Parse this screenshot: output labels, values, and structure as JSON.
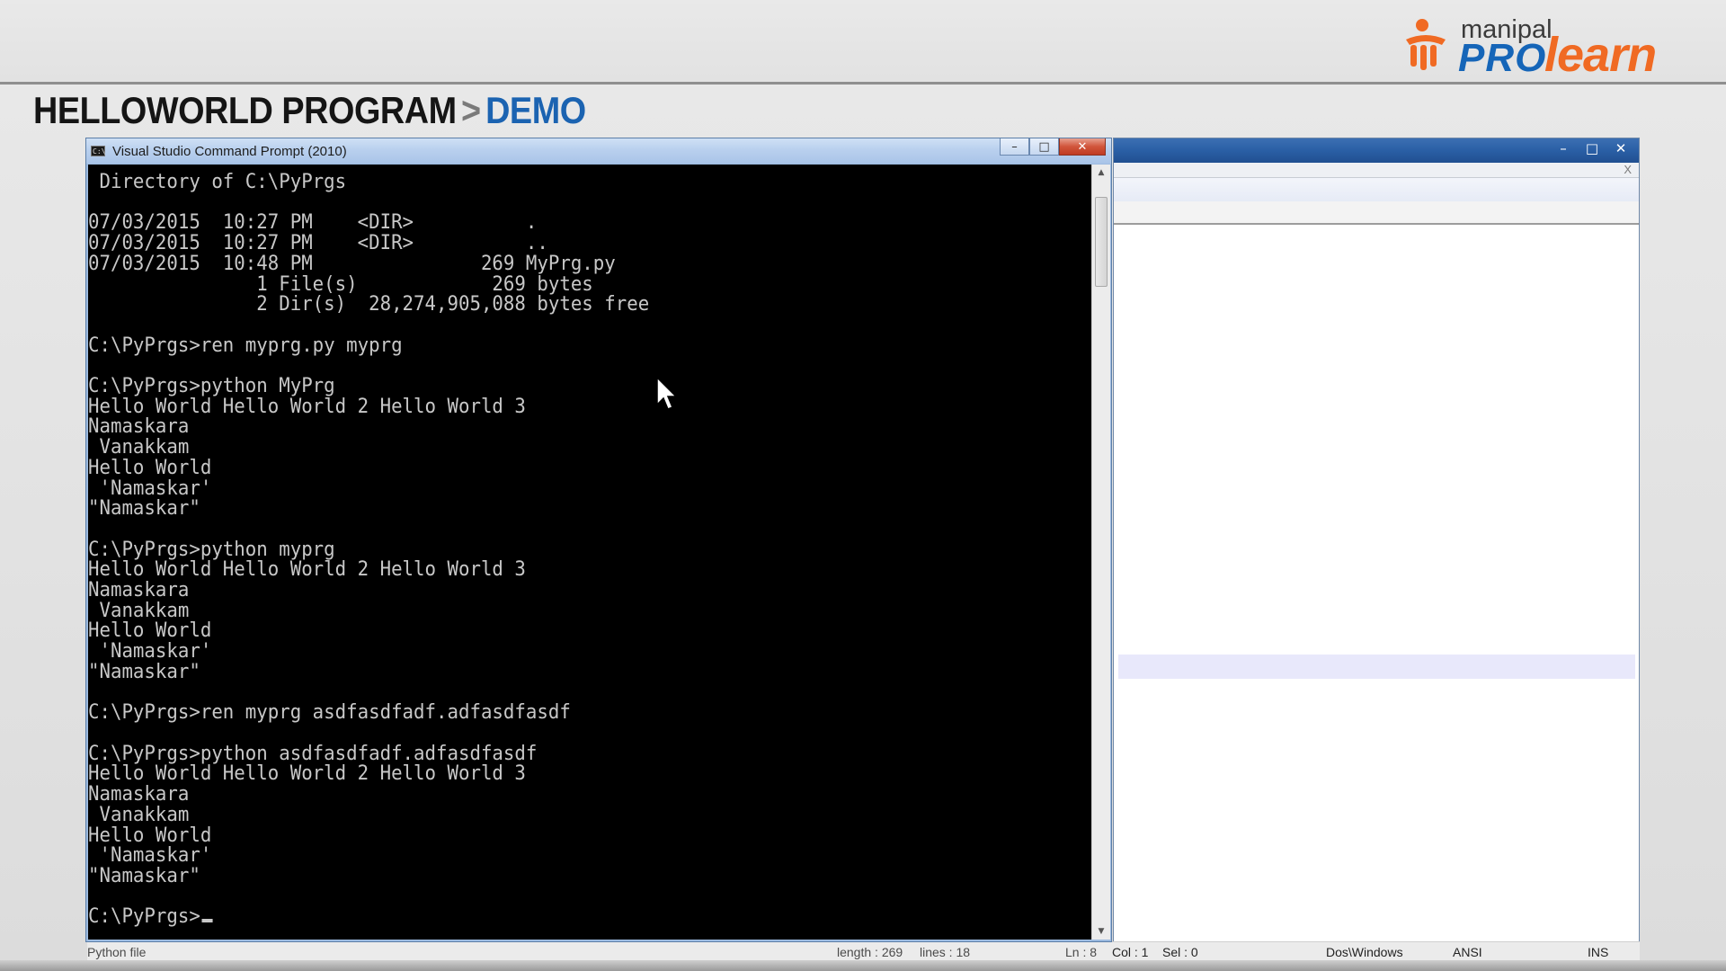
{
  "header": {
    "logo": {
      "manipal": "manipal",
      "pro": "PRO",
      "learn": "learn"
    },
    "title": "HELLOWORLD PROGRAM",
    "separator": ">",
    "subtitle": "DEMO"
  },
  "cmd_window": {
    "title": "Visual Studio Command Prompt (2010)",
    "buttons": {
      "minimize": "–",
      "maximize": "□",
      "close": "✕"
    },
    "console_lines": [
      " Directory of C:\\PyPrgs",
      "",
      "07/03/2015  10:27 PM    <DIR>          .",
      "07/03/2015  10:27 PM    <DIR>          ..",
      "07/03/2015  10:48 PM               269 MyPrg.py",
      "               1 File(s)            269 bytes",
      "               2 Dir(s)  28,274,905,088 bytes free",
      "",
      "C:\\PyPrgs>ren myprg.py myprg",
      "",
      "C:\\PyPrgs>python MyPrg",
      "Hello World Hello World 2 Hello World 3",
      "Namaskara",
      " Vanakkam",
      "Hello World",
      " 'Namaskar'",
      "\"Namaskar\"",
      "",
      "C:\\PyPrgs>python myprg",
      "Hello World Hello World 2 Hello World 3",
      "Namaskara",
      " Vanakkam",
      "Hello World",
      " 'Namaskar'",
      "\"Namaskar\"",
      "",
      "C:\\PyPrgs>ren myprg asdfasdfadf.adfasdfasdf",
      "",
      "C:\\PyPrgs>python asdfasdfadf.adfasdfasdf",
      "Hello World Hello World 2 Hello World 3",
      "Namaskara",
      " Vanakkam",
      "Hello World",
      " 'Namaskar'",
      "\"Namaskar\"",
      ""
    ],
    "prompt": "C:\\PyPrgs>"
  },
  "editor_window": {
    "buttons": {
      "minimize": "–",
      "maximize": "□",
      "close": "✕"
    },
    "tab_close": "X"
  },
  "statusbar": {
    "file_type": "Python file",
    "length": "length : 269",
    "lines": "lines : 18",
    "ln": "Ln : 8",
    "col": "Col : 1",
    "sel": "Sel : 0",
    "eol": "Dos\\Windows",
    "encoding": "ANSI",
    "mode": "INS"
  },
  "colors": {
    "console_bg": "#000000",
    "console_fg": "#c8c8c8",
    "title_blue": "#1b63b1",
    "logo_orange": "#f06a23"
  }
}
